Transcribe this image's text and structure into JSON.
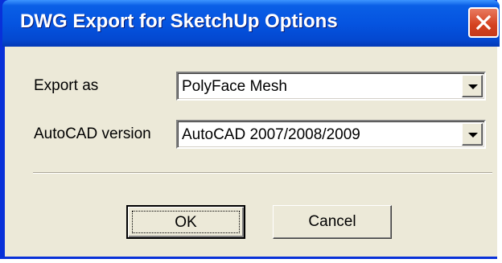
{
  "window": {
    "title": "DWG Export for SketchUp Options"
  },
  "form": {
    "export_as": {
      "label": "Export as",
      "value": "PolyFace Mesh"
    },
    "autocad_version": {
      "label": "AutoCAD version",
      "value": "AutoCAD 2007/2008/2009"
    }
  },
  "buttons": {
    "ok_label": "OK",
    "cancel_label": "Cancel"
  },
  "icons": {
    "close": "close-icon",
    "dropdown": "chevron-down-icon"
  },
  "colors": {
    "titlebar": "#0554e0",
    "dialog_background": "#ece9d8",
    "close_button": "#d4411f"
  }
}
